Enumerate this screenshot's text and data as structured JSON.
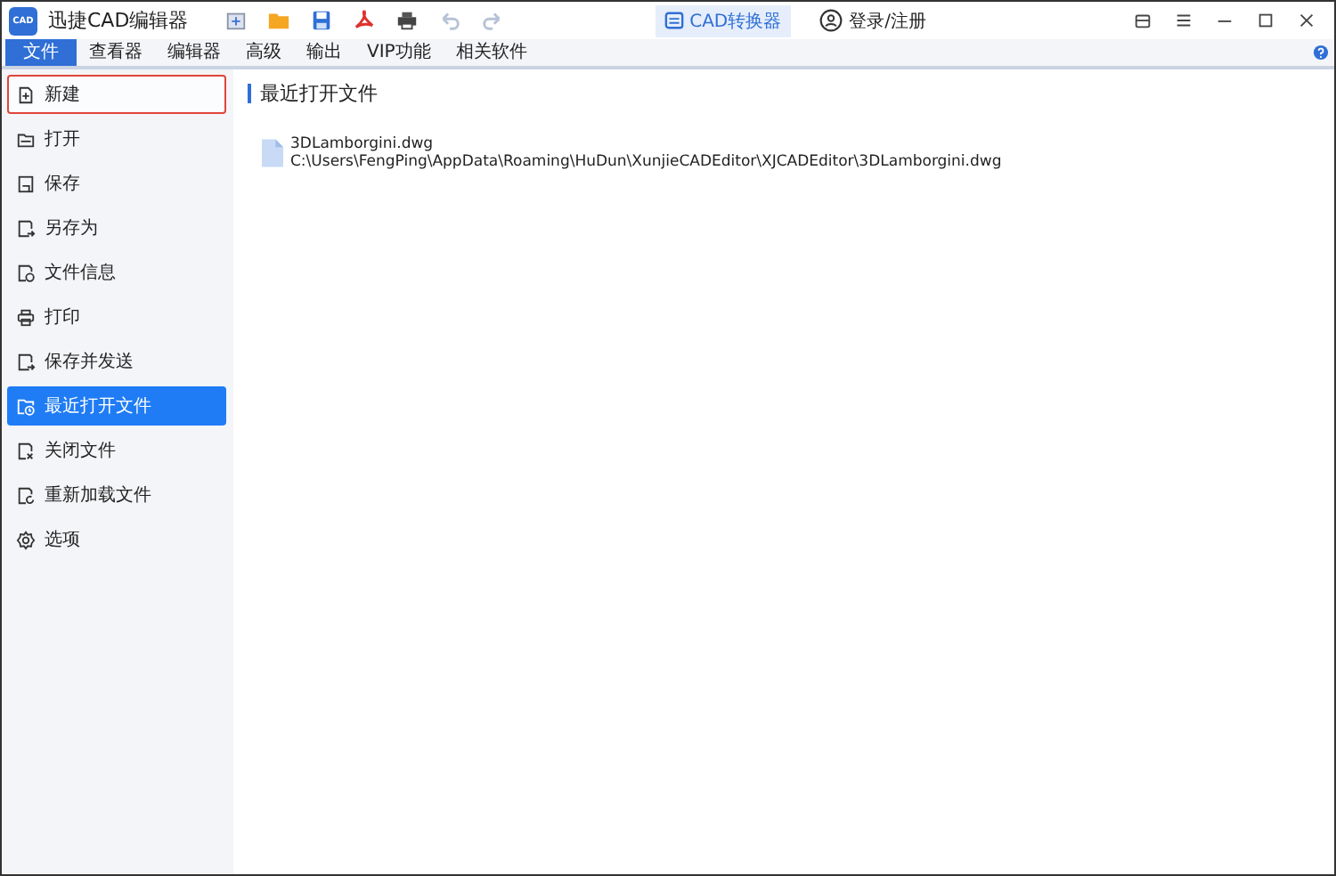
{
  "app": {
    "logo": "CAD",
    "title": "迅捷CAD编辑器"
  },
  "converter": {
    "label": "CAD转换器"
  },
  "login": {
    "label": "登录/注册"
  },
  "tabs": [
    {
      "label": "文件",
      "selected": true
    },
    {
      "label": "查看器",
      "selected": false
    },
    {
      "label": "编辑器",
      "selected": false
    },
    {
      "label": "高级",
      "selected": false
    },
    {
      "label": "输出",
      "selected": false
    },
    {
      "label": "VIP功能",
      "selected": false
    },
    {
      "label": "相关软件",
      "selected": false
    }
  ],
  "sidebar": {
    "items": [
      {
        "label": "新建",
        "selected": false,
        "focused": true
      },
      {
        "label": "打开",
        "selected": false,
        "focused": false
      },
      {
        "label": "保存",
        "selected": false,
        "focused": false
      },
      {
        "label": "另存为",
        "selected": false,
        "focused": false
      },
      {
        "label": "文件信息",
        "selected": false,
        "focused": false
      },
      {
        "label": "打印",
        "selected": false,
        "focused": false
      },
      {
        "label": "保存并发送",
        "selected": false,
        "focused": false
      },
      {
        "label": "最近打开文件",
        "selected": true,
        "focused": false
      },
      {
        "label": "关闭文件",
        "selected": false,
        "focused": false
      },
      {
        "label": "重新加载文件",
        "selected": false,
        "focused": false
      },
      {
        "label": "选项",
        "selected": false,
        "focused": false
      }
    ]
  },
  "recent": {
    "heading": "最近打开文件",
    "files": [
      {
        "name": "3DLamborgini.dwg",
        "path": "C:\\Users\\FengPing\\AppData\\Roaming\\HuDun\\XunjieCADEditor\\XJCADEditor\\3DLamborgini.dwg"
      }
    ]
  }
}
